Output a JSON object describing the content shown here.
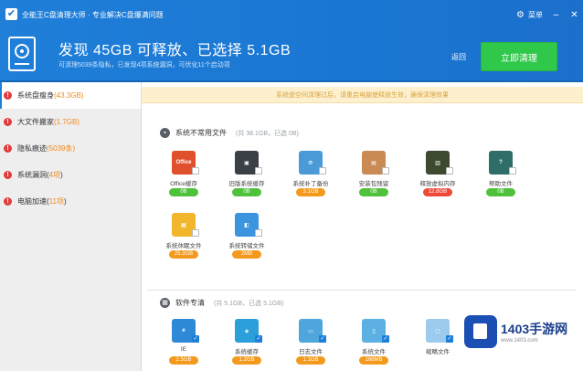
{
  "app": {
    "title": "全能王C盘清理大师 · 专业解决C盘爆满问题",
    "menu_label": "菜单"
  },
  "header": {
    "headline": "发现 45GB 可释放、已选择 5.1GB",
    "subline": "可清理5039条隐私，已发现4项系统漏洞，可优化11个启动项",
    "back_label": "返回",
    "clean_button": "立即清理"
  },
  "sidebar": {
    "items": [
      {
        "name": "系统盘瘦身",
        "count": "(43.3GB)",
        "active": true
      },
      {
        "name": "大文件搬家",
        "count": "(1.7GB)",
        "active": false
      },
      {
        "name": "隐私痕迹",
        "count": "(5039条)",
        "active": false
      },
      {
        "name": "系统漏洞(",
        "count": "4项",
        "suffix": ")",
        "active": false
      },
      {
        "name": "电脑加速(",
        "count": "11项",
        "suffix": ")",
        "active": false
      }
    ]
  },
  "banner": "系统盘空间清理过后，请重启电脑使释放生效，确保清理效果",
  "sections": [
    {
      "title": "系统不常用文件",
      "info": "(共 38.1GB，已选 0B)",
      "items": [
        {
          "label": "Office缓存",
          "size": "0B",
          "pill": "green",
          "icon": "office-icon",
          "color": "#e1502d",
          "glyph": "Office"
        },
        {
          "label": "旧版系统缓存",
          "size": "0B",
          "pill": "green",
          "icon": "old-system-icon",
          "color": "#3b3f46",
          "glyph": "▣"
        },
        {
          "label": "系统补丁备份",
          "size": "3.1GB",
          "pill": "orange",
          "icon": "patch-backup-icon",
          "color": "#4a9ad8",
          "glyph": "⟳"
        },
        {
          "label": "安装包残留",
          "size": "0B",
          "pill": "green",
          "icon": "installer-icon",
          "color": "#c98a54",
          "glyph": "▤"
        },
        {
          "label": "释放虚拟内存",
          "size": "12.8GB",
          "pill": "red",
          "icon": "virtual-memory-icon",
          "color": "#3e4a2f",
          "glyph": "▥"
        },
        {
          "label": "帮助文件",
          "size": "0B",
          "pill": "green",
          "icon": "help-file-icon",
          "color": "#2f6e68",
          "glyph": "?"
        },
        {
          "label": "系统休眠文件",
          "size": "25.3GB",
          "pill": "orange",
          "icon": "hibernate-file-icon",
          "color": "#f2b62c",
          "glyph": "▦"
        },
        {
          "label": "系统转储文件",
          "size": "2MB",
          "pill": "orange",
          "icon": "dump-file-icon",
          "color": "#3c94de",
          "glyph": "◧"
        }
      ]
    },
    {
      "title": "软件专清",
      "info": "(共 5.1GB，已选 5.1GB)",
      "items": [
        {
          "label": "IE",
          "size": "2.5GB",
          "pill": "orange",
          "icon": "ie-icon",
          "color": "#2e8ad6",
          "glyph": "e"
        },
        {
          "label": "系统缓存",
          "size": "1.2GB",
          "pill": "orange",
          "icon": "system-cache-icon",
          "color": "#2b9fd9",
          "glyph": "◈"
        },
        {
          "label": "日志文件",
          "size": "1.1GB",
          "pill": "orange",
          "icon": "log-file-icon",
          "color": "#4fa6dd",
          "glyph": "▭"
        },
        {
          "label": "系统文件",
          "size": "168MB",
          "pill": "orange",
          "icon": "system-file-icon",
          "color": "#5cb0e4",
          "glyph": "▯"
        },
        {
          "label": "缩略文件",
          "size": "",
          "pill": "orange",
          "icon": "thumbnail-file-icon",
          "color": "#9ccbee",
          "glyph": "▢"
        }
      ]
    }
  ],
  "watermark": {
    "brand": "1403手游网",
    "url": "www.1403.com"
  },
  "colors": {
    "header_blue": "#1a76d2",
    "clean_green": "#2fc84a",
    "warn_red": "#e23b3b",
    "count_orange": "#f08a1c"
  }
}
